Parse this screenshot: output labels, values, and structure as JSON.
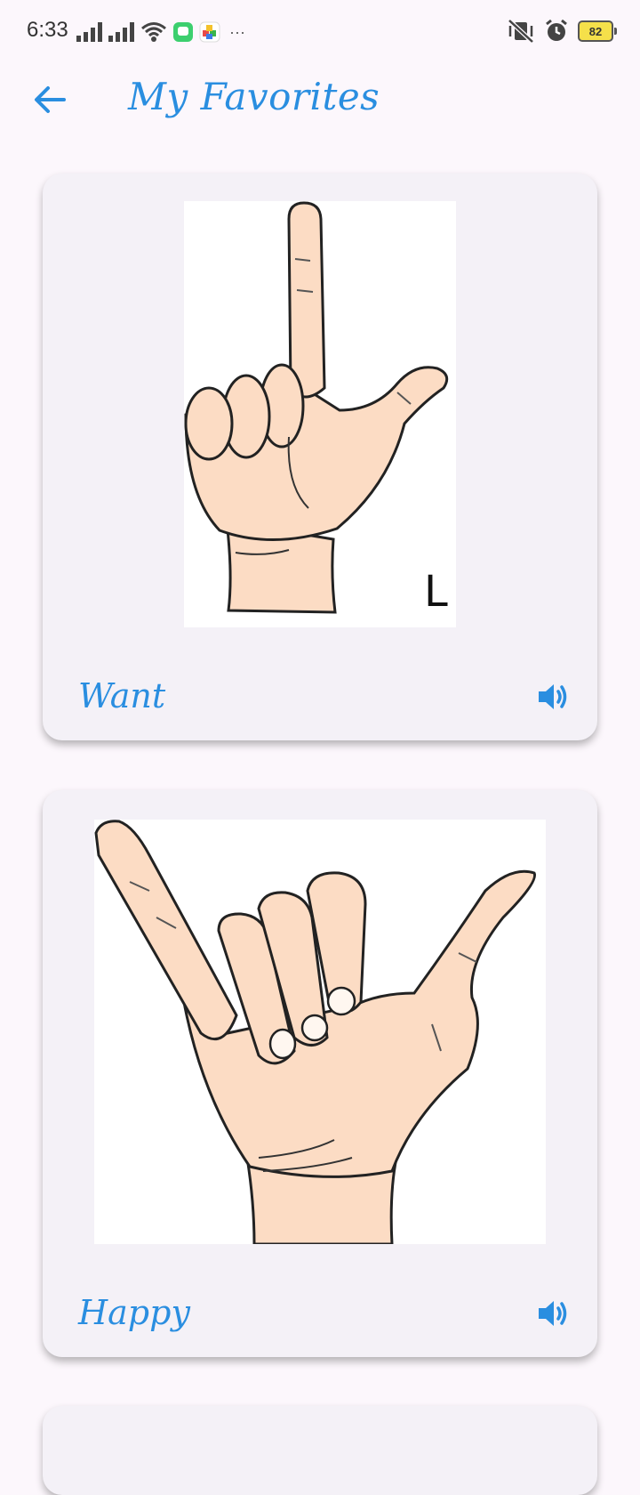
{
  "status_bar": {
    "time": "6:33",
    "battery": "82",
    "more": "···"
  },
  "header": {
    "title": "My Favorites"
  },
  "favorites": [
    {
      "label": "Want",
      "image_letter": "L"
    },
    {
      "label": "Happy"
    }
  ],
  "colors": {
    "accent": "#2a8ee0",
    "background": "#fcf7fc",
    "card": "#f4f1f7",
    "skin": "#fcdcc4"
  }
}
